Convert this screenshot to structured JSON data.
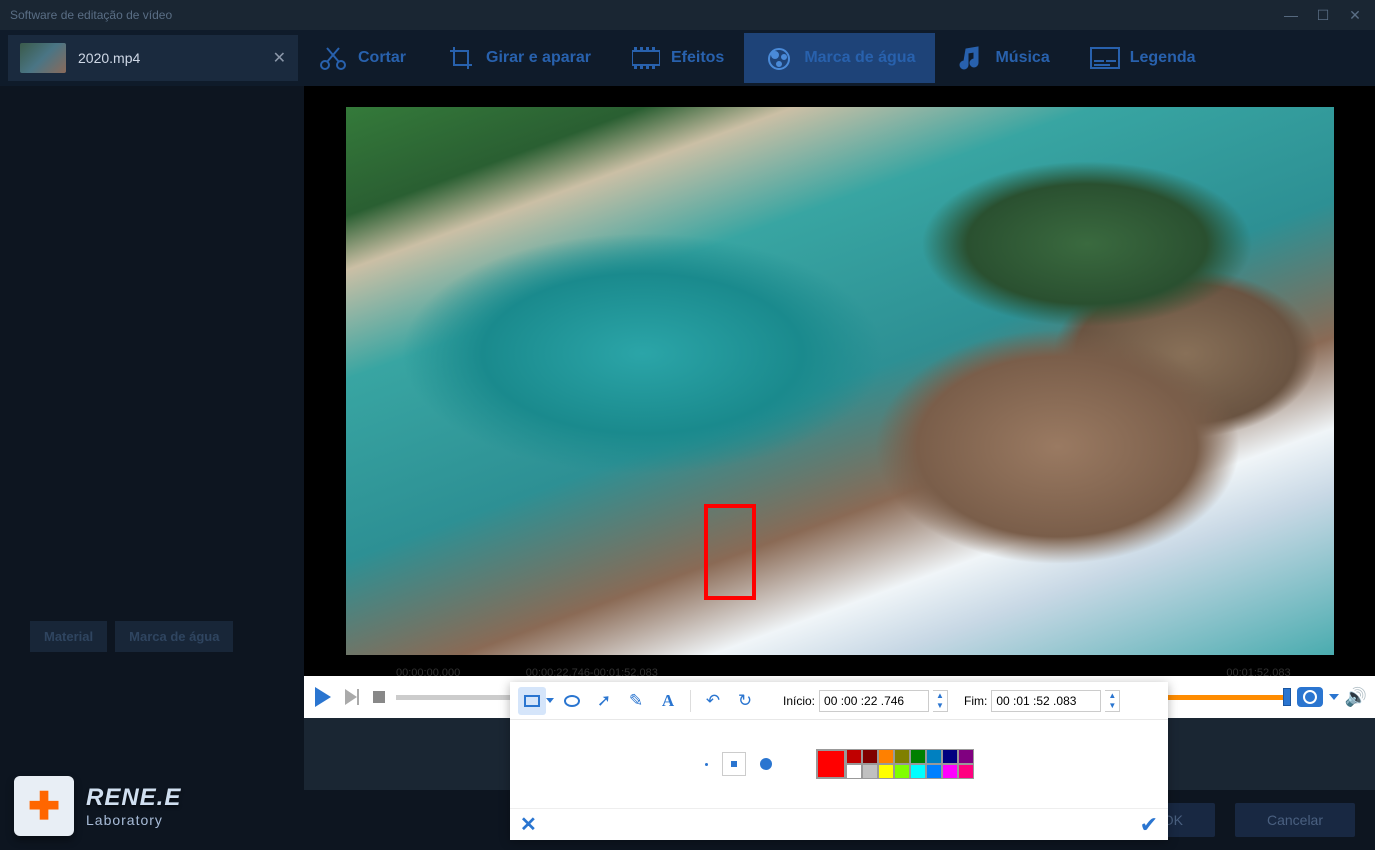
{
  "window": {
    "title": "Software de editação de vídeo"
  },
  "file": {
    "name": "2020.mp4"
  },
  "tools": [
    {
      "id": "cut",
      "label": "Cortar"
    },
    {
      "id": "rotate",
      "label": "Girar e aparar"
    },
    {
      "id": "effects",
      "label": "Efeitos"
    },
    {
      "id": "watermark",
      "label": "Marca de água",
      "active": true
    },
    {
      "id": "music",
      "label": "Música"
    },
    {
      "id": "subtitle",
      "label": "Legenda"
    }
  ],
  "sidebar": {
    "tabs": [
      "Material",
      "Marca de água"
    ]
  },
  "timeline": {
    "start_label": "00:00:00.000",
    "range_label": "00:00:22.746-00:01:52.083",
    "end_label": "00:01:52.083",
    "sel_start_pct": 20.3,
    "sel_end_pct": 100
  },
  "editor": {
    "start_label": "Início:",
    "start_value": "00 :00 :22 .746",
    "end_label": "Fim:",
    "end_value": "00 :01 :52 .083",
    "main_color": "#ff0000",
    "palette_row1": [
      "#c00000",
      "#800000",
      "#ff8000",
      "#808000",
      "#008000",
      "#0080c0",
      "#000080",
      "#800080"
    ],
    "palette_row2": [
      "#ffffff",
      "#c0c0c0",
      "#ffff00",
      "#80ff00",
      "#00ffff",
      "#0080ff",
      "#ff00ff",
      "#ff0080"
    ]
  },
  "buttons": {
    "ok": "OK",
    "cancel": "Cancelar"
  },
  "brand": {
    "name": "RENE.E",
    "sub": "Laboratory"
  }
}
